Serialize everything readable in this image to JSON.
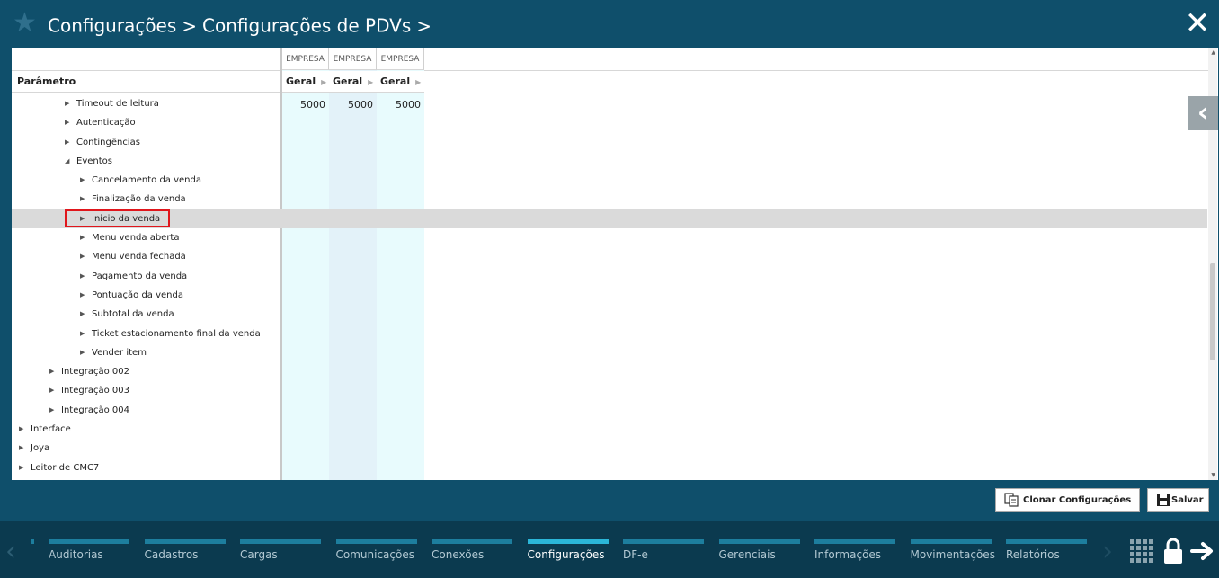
{
  "header": {
    "crumb1": "Configurações",
    "crumb2": "Configurações de PDVs",
    "sep": ">",
    "sep_after": ">"
  },
  "table": {
    "param_header": "Parâmetro",
    "columns": [
      {
        "group": "EMPRESA",
        "sub": "Geral",
        "value": "5000"
      },
      {
        "group": "EMPRESA",
        "sub": "Geral",
        "value": "5000"
      },
      {
        "group": "EMPRESA",
        "sub": "Geral",
        "value": "5000"
      }
    ],
    "rows": [
      {
        "label": "Timeout de leitura",
        "level": 3,
        "expanded": false,
        "selected": false
      },
      {
        "label": "Autenticação",
        "level": 3,
        "expanded": false,
        "selected": false
      },
      {
        "label": "Contingências",
        "level": 3,
        "expanded": false,
        "selected": false
      },
      {
        "label": "Eventos",
        "level": 3,
        "expanded": true,
        "selected": false
      },
      {
        "label": "Cancelamento da venda",
        "level": 4,
        "expanded": false,
        "selected": false
      },
      {
        "label": "Finalização da venda",
        "level": 4,
        "expanded": false,
        "selected": false
      },
      {
        "label": "Inicio da venda",
        "level": 4,
        "expanded": false,
        "selected": true
      },
      {
        "label": "Menu venda aberta",
        "level": 4,
        "expanded": false,
        "selected": false
      },
      {
        "label": "Menu venda fechada",
        "level": 4,
        "expanded": false,
        "selected": false
      },
      {
        "label": "Pagamento da venda",
        "level": 4,
        "expanded": false,
        "selected": false
      },
      {
        "label": "Pontuação da venda",
        "level": 4,
        "expanded": false,
        "selected": false
      },
      {
        "label": "Subtotal da venda",
        "level": 4,
        "expanded": false,
        "selected": false
      },
      {
        "label": "Ticket estacionamento final da venda",
        "level": 4,
        "expanded": false,
        "selected": false
      },
      {
        "label": "Vender item",
        "level": 4,
        "expanded": false,
        "selected": false
      },
      {
        "label": "Integração 002",
        "level": 2,
        "expanded": false,
        "selected": false
      },
      {
        "label": "Integração 003",
        "level": 2,
        "expanded": false,
        "selected": false
      },
      {
        "label": "Integração 004",
        "level": 2,
        "expanded": false,
        "selected": false
      },
      {
        "label": "Interface",
        "level": 1,
        "expanded": false,
        "selected": false
      },
      {
        "label": "Joya",
        "level": 1,
        "expanded": false,
        "selected": false
      },
      {
        "label": "Leitor de CMC7",
        "level": 1,
        "expanded": false,
        "selected": false
      }
    ]
  },
  "actions": {
    "clone_label": "Clonar Configurações",
    "save_label": "Salvar"
  },
  "nav": {
    "items": [
      {
        "label": "Auditorias",
        "active": false
      },
      {
        "label": "Cadastros",
        "active": false
      },
      {
        "label": "Cargas",
        "active": false
      },
      {
        "label": "Comunicações",
        "active": false
      },
      {
        "label": "Conexões",
        "active": false
      },
      {
        "label": "Configurações",
        "active": true
      },
      {
        "label": "DF-e",
        "active": false
      },
      {
        "label": "Gerenciais",
        "active": false
      },
      {
        "label": "Informações",
        "active": false
      },
      {
        "label": "Movimentações",
        "active": false
      },
      {
        "label": "Relatórios",
        "active": false
      }
    ]
  },
  "colors": {
    "header_bg": "#0f4f6b",
    "nav_bg": "#0b3a4f",
    "accent": "#2bb6d8",
    "highlight_border": "#e0161c"
  },
  "icons": [
    "star-icon",
    "close-icon",
    "collapse-panel-icon",
    "clone-icon",
    "save-icon",
    "grid-icon",
    "lock-icon",
    "logout-arrow-icon"
  ]
}
